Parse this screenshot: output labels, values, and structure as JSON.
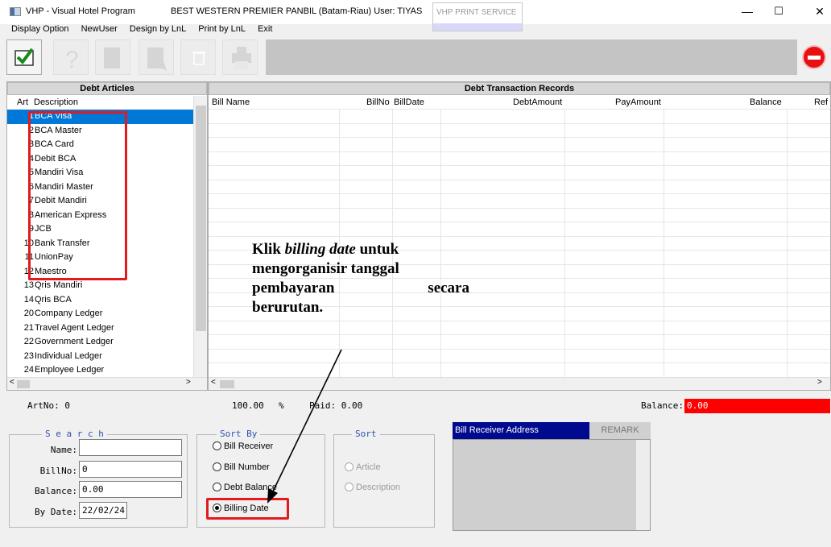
{
  "titlebar": {
    "app_title": "VHP - Visual Hotel Program",
    "hotel_title": "BEST WESTERN PREMIER PANBIL (Batam-Riau) User: TIYAS",
    "print_service_tab": "VHP PRINT SERVICE",
    "minimize": "—",
    "maximize": "☐",
    "close": "✕"
  },
  "menu": {
    "items": [
      "Display Option",
      "NewUser",
      "Design by LnL",
      "Print by LnL",
      "Exit"
    ]
  },
  "left_panel": {
    "title": "Debt Articles",
    "col_art": "Art",
    "col_desc": "Description",
    "sort_indicator": "^",
    "rows": [
      {
        "num": "1",
        "desc": "BCA Visa"
      },
      {
        "num": "2",
        "desc": "BCA Master"
      },
      {
        "num": "3",
        "desc": "BCA Card"
      },
      {
        "num": "4",
        "desc": "Debit BCA"
      },
      {
        "num": "5",
        "desc": "Mandiri Visa"
      },
      {
        "num": "6",
        "desc": "Mandiri Master"
      },
      {
        "num": "7",
        "desc": "Debit Mandiri"
      },
      {
        "num": "8",
        "desc": "American Express"
      },
      {
        "num": "9",
        "desc": "JCB"
      },
      {
        "num": "10",
        "desc": "Bank Transfer"
      },
      {
        "num": "11",
        "desc": "UnionPay"
      },
      {
        "num": "12",
        "desc": "Maestro"
      },
      {
        "num": "13",
        "desc": "Qris Mandiri"
      },
      {
        "num": "14",
        "desc": "Qris BCA"
      },
      {
        "num": "20",
        "desc": "Company Ledger"
      },
      {
        "num": "21",
        "desc": "Travel Agent Ledger"
      },
      {
        "num": "22",
        "desc": "Government Ledger"
      },
      {
        "num": "23",
        "desc": "Individual Ledger"
      },
      {
        "num": "24",
        "desc": "Employee Ledger"
      }
    ]
  },
  "right_panel": {
    "title": "Debt Transaction Records",
    "columns": [
      "Bill Name",
      "BillNo",
      "BillDate",
      "DebtAmount",
      "PayAmount",
      "Balance",
      "Ref"
    ]
  },
  "status": {
    "artno": "ArtNo: 0",
    "percent_value": "100.00",
    "percent_sign": "%",
    "paid": "Paid: 0.00",
    "balance_label": "Balance:",
    "balance_value": "0.00"
  },
  "search": {
    "title": "S e a r c h",
    "name_label": "Name:",
    "name_value": "",
    "billno_label": "BillNo:",
    "billno_value": "0",
    "balance_label": "Balance:",
    "balance_value": "0.00",
    "bydate_label": "By Date:",
    "bydate_value": "22/02/24"
  },
  "sort_by": {
    "title": "Sort By",
    "options": [
      "Bill Receiver",
      "Bill Number",
      "Debt Balance",
      "Billing Date"
    ],
    "selected": "Billing Date"
  },
  "sort": {
    "title": "Sort",
    "options": [
      "Article",
      "Description"
    ]
  },
  "bill_receiver": {
    "tab_label": "Bill Receiver Address",
    "remark_label": "REMARK"
  },
  "annotation": {
    "line1_pre": "Klik ",
    "line1_italic": "billing date",
    "line1_post": " untuk",
    "line2": "mengorganisir tanggal",
    "line3_a": "pembayaran",
    "line3_b": "secara",
    "line4": "berurutan."
  },
  "colors": {
    "selection": "#0078d7",
    "highlight_red": "#e4191d",
    "balance_red": "#ff0000",
    "tab_navy": "#000a8e"
  }
}
